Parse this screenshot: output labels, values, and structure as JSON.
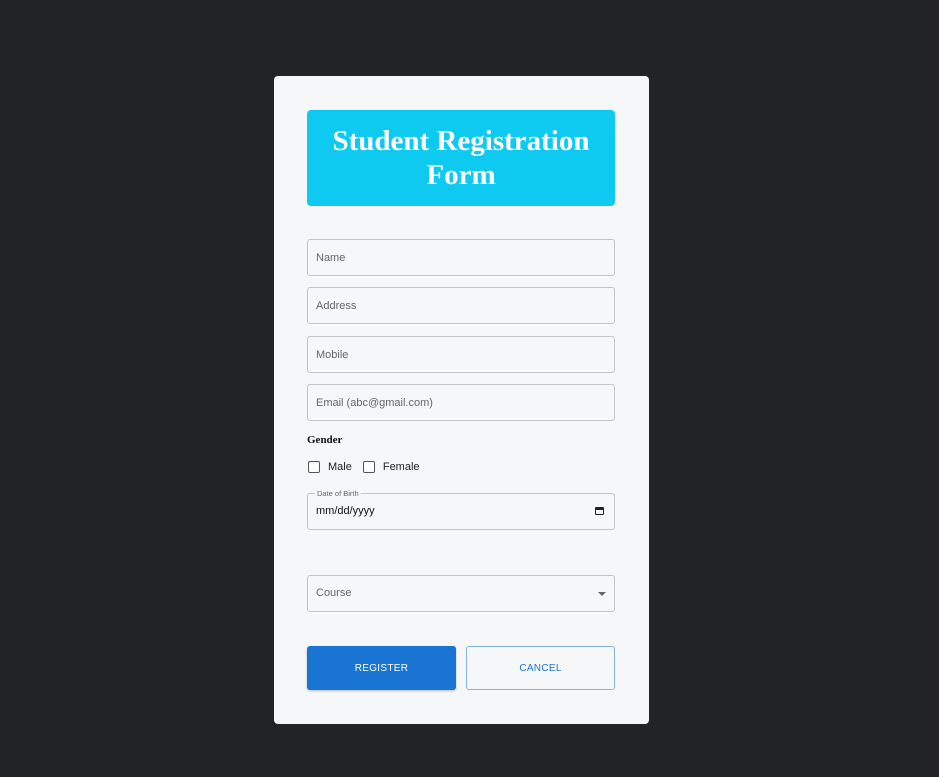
{
  "form": {
    "title": "Student Registration Form",
    "fields": {
      "name": {
        "placeholder": "Name"
      },
      "address": {
        "placeholder": "Address"
      },
      "mobile": {
        "placeholder": "Mobile"
      },
      "email": {
        "placeholder": "Email (abc@gmail.com)"
      }
    },
    "gender": {
      "label": "Gender",
      "options": [
        "Male",
        "Female"
      ]
    },
    "dob": {
      "legend": "Date of Birth",
      "value": "mm/dd/yyyy"
    },
    "course": {
      "label": "Course"
    },
    "buttons": {
      "register": "REGISTER",
      "cancel": "CANCEL"
    }
  },
  "colors": {
    "background": "#212327",
    "card": "#f6f7f9",
    "header": "#0ecaf0",
    "primary": "#1a74d3"
  },
  "icons": [
    "calendar-icon",
    "chevron-down-icon",
    "checkbox-icon"
  ]
}
